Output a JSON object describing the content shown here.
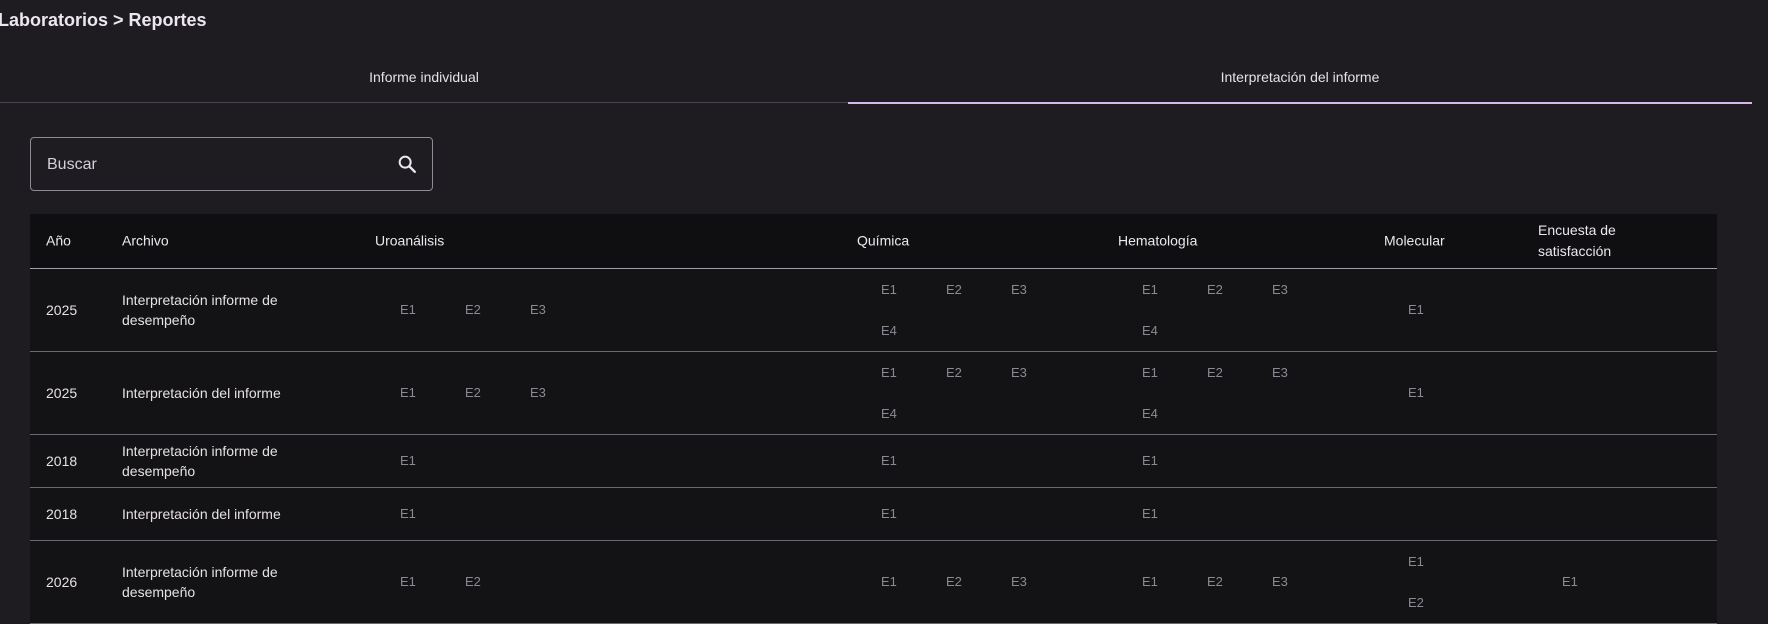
{
  "breadcrumb": "Laboratorios > Reportes",
  "tabs": [
    {
      "label": "Informe individual",
      "active": false
    },
    {
      "label": "Interpretación del informe",
      "active": true
    }
  ],
  "search": {
    "placeholder": "Buscar",
    "value": ""
  },
  "table": {
    "headers": [
      "Año",
      "Archivo",
      "Uroanálisis",
      "Química",
      "Hematología",
      "Molecular",
      "Encuesta de satisfacción"
    ],
    "rows": [
      {
        "year": "2025",
        "file": "Interpretación informe de desempeño",
        "uroanalisis": [
          "E1",
          "E2",
          "E3"
        ],
        "quimica": [
          "E1",
          "E2",
          "E3",
          "E4"
        ],
        "hematologia": [
          "E1",
          "E2",
          "E3",
          "E4"
        ],
        "molecular": [
          "E1"
        ],
        "encuesta": []
      },
      {
        "year": "2025",
        "file": "Interpretación del informe",
        "uroanalisis": [
          "E1",
          "E2",
          "E3"
        ],
        "quimica": [
          "E1",
          "E2",
          "E3",
          "E4"
        ],
        "hematologia": [
          "E1",
          "E2",
          "E3",
          "E4"
        ],
        "molecular": [
          "E1"
        ],
        "encuesta": []
      },
      {
        "year": "2018",
        "file": "Interpretación informe de desempeño",
        "uroanalisis": [
          "E1"
        ],
        "quimica": [
          "E1"
        ],
        "hematologia": [
          "E1"
        ],
        "molecular": [],
        "encuesta": []
      },
      {
        "year": "2018",
        "file": "Interpretación del informe",
        "uroanalisis": [
          "E1"
        ],
        "quimica": [
          "E1"
        ],
        "hematologia": [
          "E1"
        ],
        "molecular": [],
        "encuesta": []
      },
      {
        "year": "2026",
        "file": "Interpretación informe de desempeño",
        "uroanalisis": [
          "E1",
          "E2"
        ],
        "quimica": [
          "E1",
          "E2",
          "E3"
        ],
        "hematologia": [
          "E1",
          "E2",
          "E3"
        ],
        "molecular": [
          "E1",
          "E2"
        ],
        "encuesta": [
          "E1"
        ]
      }
    ]
  },
  "colors": {
    "accent": "#d7b8e6",
    "background": "#1e1c20",
    "table": "#131215"
  }
}
